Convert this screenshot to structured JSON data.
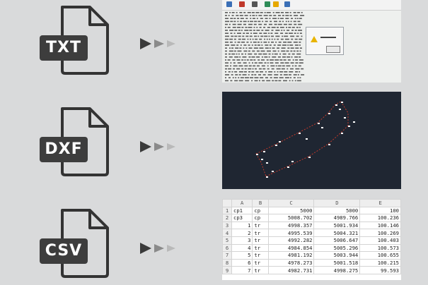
{
  "colors": {
    "background": "#d9dadb",
    "icon_stroke": "#333333",
    "badge": "#3d3d3d",
    "arrow_dark": "#3a3a3a",
    "arrow_mid": "#8a8a8a",
    "arrow_light": "#b9b9b9",
    "dxf_bg": "#1f2632"
  },
  "rows": [
    {
      "label": "TXT",
      "preview": "text-file-viewer-screenshot"
    },
    {
      "label": "DXF",
      "preview": "cad-drawing-screenshot"
    },
    {
      "label": "CSV",
      "preview": "spreadsheet-screenshot"
    }
  ],
  "csv": {
    "columns": [
      "",
      "A",
      "B",
      "C",
      "D",
      "E"
    ],
    "rows": [
      [
        "1",
        "cp1",
        "cp",
        "5000",
        "5000",
        "100"
      ],
      [
        "2",
        "cp3",
        "cp",
        "5008.702",
        "4989.766",
        "100.236"
      ],
      [
        "3",
        "1",
        "tr",
        "4998.357",
        "5001.934",
        "100.146"
      ],
      [
        "4",
        "2",
        "tr",
        "4995.539",
        "5004.321",
        "100.269"
      ],
      [
        "5",
        "3",
        "tr",
        "4992.282",
        "5006.647",
        "100.403"
      ],
      [
        "6",
        "4",
        "tr",
        "4984.854",
        "5005.296",
        "100.573"
      ],
      [
        "7",
        "5",
        "tr",
        "4981.192",
        "5003.944",
        "100.655"
      ],
      [
        "8",
        "6",
        "tr",
        "4978.273",
        "5001.518",
        "100.215"
      ],
      [
        "9",
        "7",
        "tr",
        "4982.731",
        "4998.275",
        "99.593"
      ]
    ]
  }
}
